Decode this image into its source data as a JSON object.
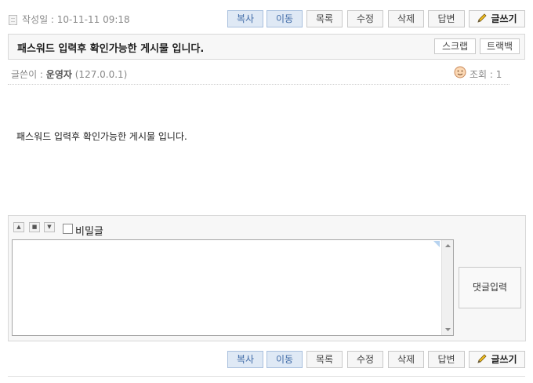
{
  "post": {
    "date_text": "작성일 : 10-11-11 09:18",
    "title": "패스워드 입력후 확인가능한 게시물 입니다.",
    "author_label": "글쓴이 : ",
    "author_name": "운영자",
    "author_ip": "(127.0.0.1)",
    "views": "조회 : 1",
    "content": "패스워드 입력후 확인가능한 게시물 입니다."
  },
  "toolbar": {
    "copy": "복사",
    "move": "이동",
    "list": "목록",
    "edit": "수정",
    "delete": "삭제",
    "reply": "답변",
    "write": "글쓰기"
  },
  "title_actions": {
    "scrap": "스크랩",
    "trackback": "트랙백"
  },
  "comment": {
    "secret_label": "비밀글",
    "secret_checked": false,
    "textarea_value": "",
    "submit": "댓글입력"
  }
}
